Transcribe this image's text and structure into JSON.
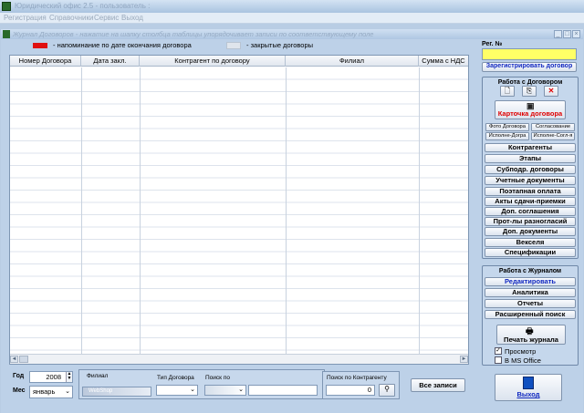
{
  "app": {
    "title": "Юридический офис 2.5 - пользователь :"
  },
  "menu": [
    "Регистрация",
    "Справочники",
    "Сервис",
    "Выход"
  ],
  "journal": {
    "title": "Журнал Договоров - нажатие на шапку столбца таблицы упорядочивает записи по соответствующему поле"
  },
  "legend": {
    "reminder": "- напоминание по дате окончания договора",
    "closed": "- закрытые договоры"
  },
  "colors": {
    "reminder": "#e01010",
    "closed": "#dfe5ec",
    "link": "#1028c0",
    "danger": "#e00000"
  },
  "table": {
    "columns": [
      "Номер Договора",
      "Дата закл.",
      "Контрагент по договору",
      "Филиал",
      "Сумма с НДС"
    ]
  },
  "reg": {
    "label": "Рег. №",
    "value": "",
    "register_btn": "Зарегистрировать договор"
  },
  "contracts": {
    "title": "Работа с Договором",
    "card_btn": "Карточка договора",
    "small": [
      "Фото Договора",
      "Согласование",
      "Исполне-Догра",
      "Исполне-Согл-я"
    ],
    "buttons": [
      "Контрагенты",
      "Этапы",
      "Субподр. договоры",
      "Учетные документы",
      "Поэтапная оплата",
      "Акты сдачи-приемки",
      "Доп. соглашения",
      "Прот-лы разногласий",
      "Доп. документы",
      "Векселя",
      "Спецификации"
    ]
  },
  "journalops": {
    "title": "Работа с Журналом",
    "buttons": [
      "Редактировать",
      "Аналитика",
      "Отчеты",
      "Расширенный поиск"
    ],
    "print": "Печать журнала",
    "preview": "Просмотр",
    "preview_checked": true,
    "msoffice": "В MS Office",
    "msoffice_checked": false
  },
  "filters": {
    "year_label": "Год",
    "year": "2008",
    "month_label": "Мес",
    "month": "январь",
    "branch_label": "Филиал",
    "branch_value": "WebShop",
    "type_label": "Тип Договора",
    "search_label": "Поиск по",
    "counterparty_label": "Поиск по Контрагенту",
    "counterparty_value": "0",
    "all_btn": "Все записи"
  },
  "exit": "Выход"
}
